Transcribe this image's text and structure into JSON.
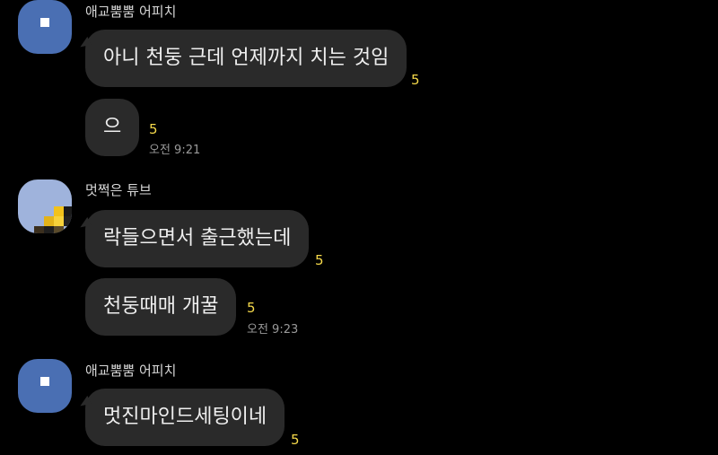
{
  "messages": [
    {
      "sender": "애교뿜뿜 어피치",
      "bubbles": [
        {
          "text": "아니 천둥 근데 언제까지 치는 것임",
          "unread": "5"
        },
        {
          "text": "으",
          "unread": "5",
          "time": "오전 9:21"
        }
      ]
    },
    {
      "sender": "멋쩍은 튜브",
      "bubbles": [
        {
          "text": "락들으면서 출근했는데",
          "unread": "5"
        },
        {
          "text": "천둥때매 개꿀",
          "unread": "5",
          "time": "오전 9:23"
        }
      ]
    },
    {
      "sender": "애교뿜뿜 어피치",
      "bubbles": [
        {
          "text": "멋진마인드세팅이네",
          "unread": "5"
        }
      ]
    }
  ],
  "colors": {
    "background": "#000000",
    "bubble": "#2a2a2a",
    "unread_count": "#f5d94a",
    "avatar_peach": "#4a6fb3",
    "avatar_tube": "#9fb3dc"
  },
  "icons": {
    "peach_avatar": "peach-profile-icon",
    "tube_avatar": "tube-profile-icon"
  }
}
